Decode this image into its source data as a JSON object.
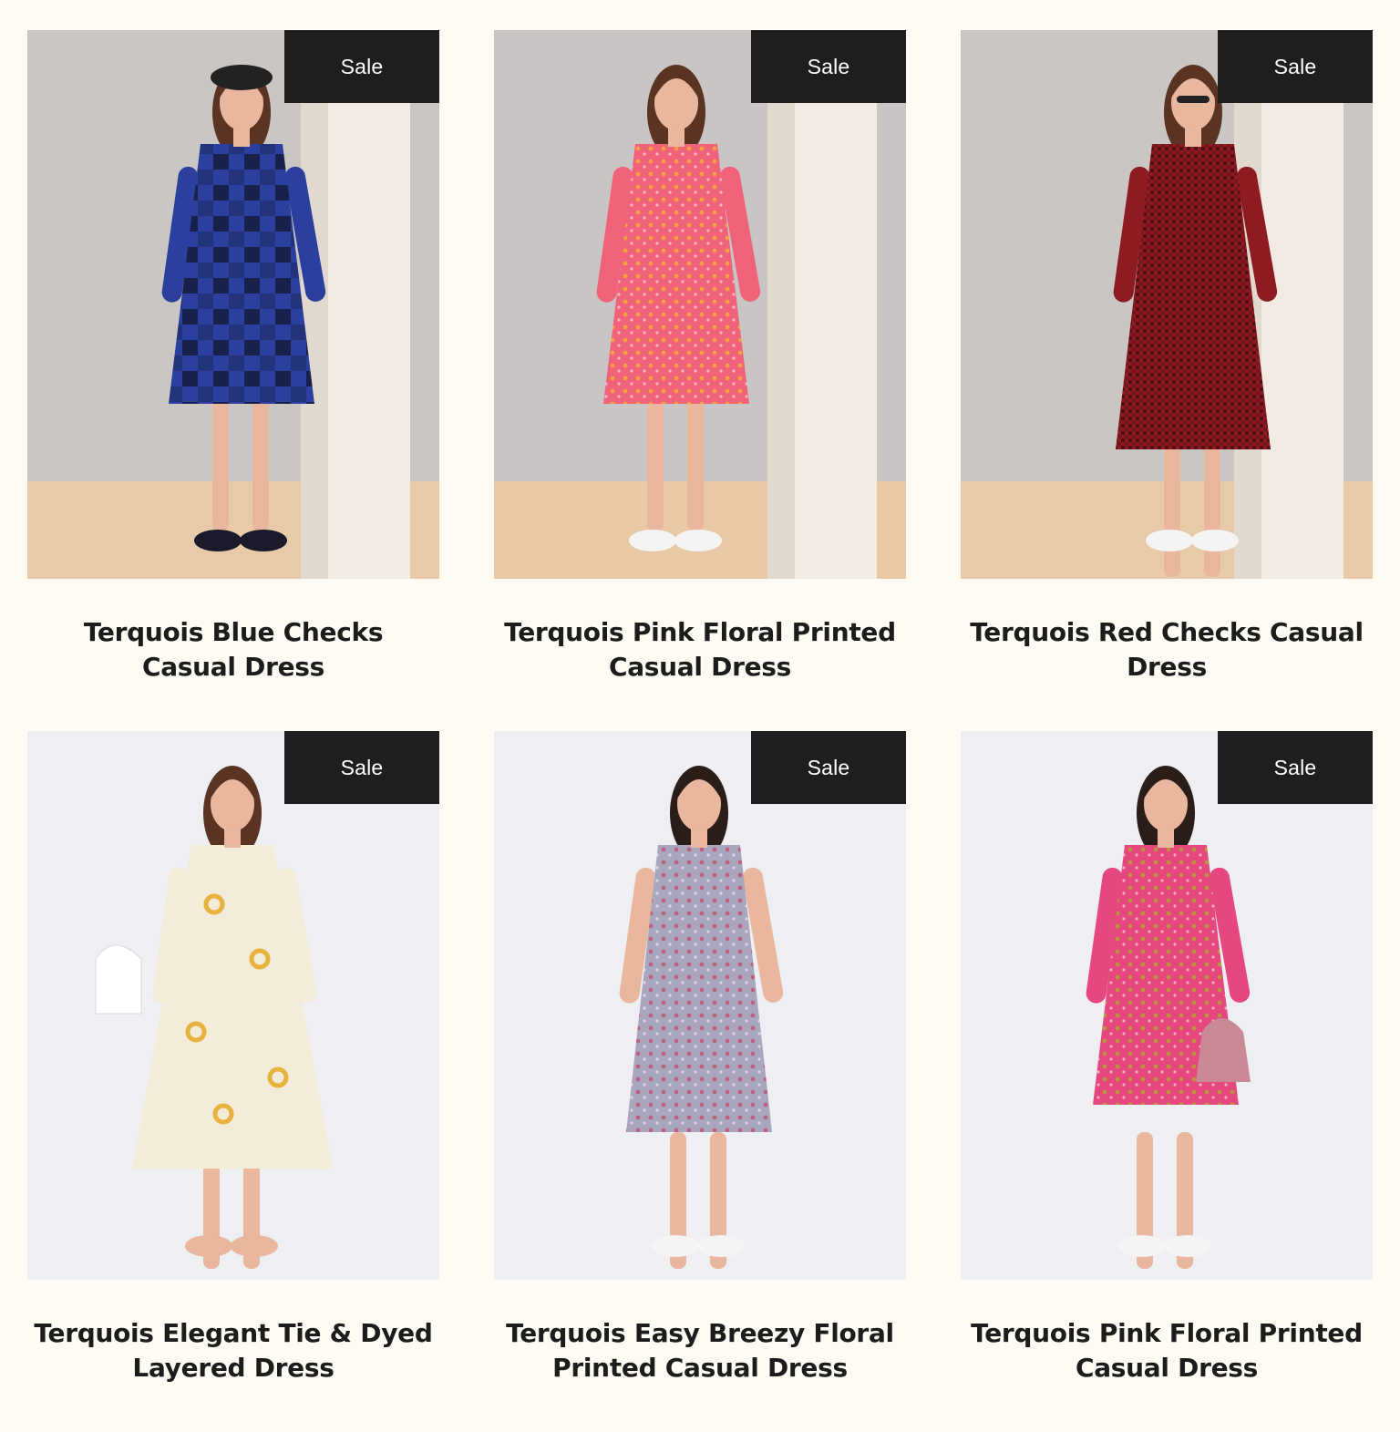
{
  "sale_label": "Sale",
  "products": [
    {
      "title": "Terquois Blue Checks Casual Dress",
      "badge": "Sale",
      "image_icon": "model-blue-check-dress-image",
      "dress_color": "#2a3f9e",
      "accent_color": "#141c3c",
      "bg_color": "#c9c6c4",
      "floor_color": "#e8c9a8"
    },
    {
      "title": "Terquois Pink Floral Printed Casual Dress",
      "badge": "Sale",
      "image_icon": "model-pink-floral-dress-image",
      "dress_color": "#f0617a",
      "accent_color": "#f5a33a",
      "bg_color": "#c8c5c4",
      "floor_color": "#e9c8a6"
    },
    {
      "title": "Terquois Red Checks Casual Dress",
      "badge": "Sale",
      "image_icon": "model-red-check-dress-image",
      "dress_color": "#8e1a22",
      "accent_color": "#4a0c10",
      "bg_color": "#c9c6c4",
      "floor_color": "#e8c9a8"
    },
    {
      "title": "Terquois Elegant Tie & Dyed Layered Dress",
      "badge": "Sale",
      "image_icon": "model-cream-tiedye-dress-image",
      "dress_color": "#f3ecd9",
      "accent_color": "#e7b33c",
      "bg_color": "#eeeff2",
      "floor_color": "#eeeff2"
    },
    {
      "title": "Terquois Easy Breezy Floral Printed Casual Dress",
      "badge": "Sale",
      "image_icon": "model-grey-floral-dress-image",
      "dress_color": "#a9a7bd",
      "accent_color": "#c0597e",
      "bg_color": "#eeeff2",
      "floor_color": "#eeeff2"
    },
    {
      "title": "Terquois Pink Floral Printed Casual Dress",
      "badge": "Sale",
      "image_icon": "model-pink-print-dress-image",
      "dress_color": "#e6477f",
      "accent_color": "#b89a3a",
      "bg_color": "#eeeff2",
      "floor_color": "#eeeff2"
    }
  ]
}
